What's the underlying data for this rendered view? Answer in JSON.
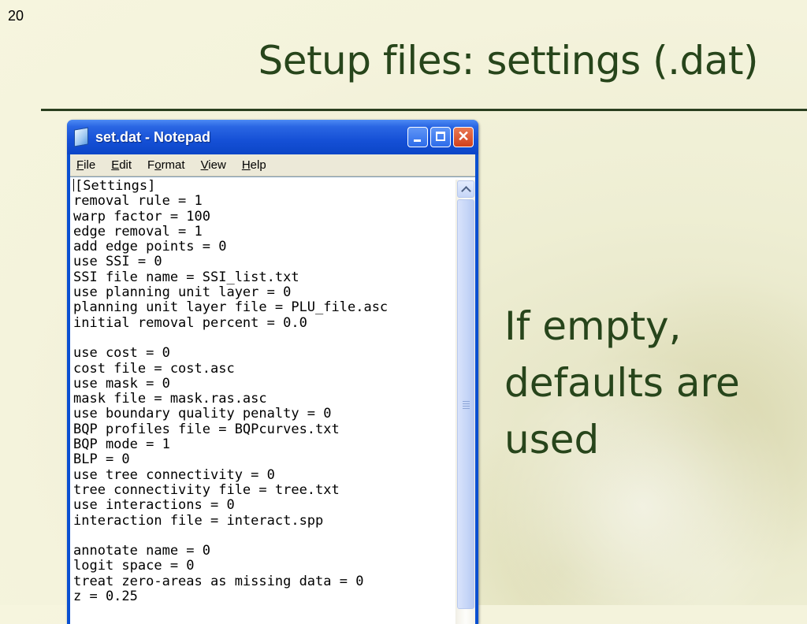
{
  "slide": {
    "number": "20",
    "title": "Setup files: settings (.dat)",
    "side_text": [
      "If empty,",
      "defaults are",
      "used"
    ]
  },
  "window": {
    "title": "set.dat - Notepad",
    "controls": {
      "minimize": "minimize",
      "maximize": "maximize",
      "close": "✕"
    }
  },
  "menu": [
    {
      "label": "File",
      "mnemonic": "F",
      "rest": "ile"
    },
    {
      "label": "Edit",
      "mnemonic": "E",
      "rest": "dit"
    },
    {
      "label": "Format",
      "mnemonic": "o",
      "pre": "F",
      "rest": "rmat"
    },
    {
      "label": "View",
      "mnemonic": "V",
      "rest": "iew"
    },
    {
      "label": "Help",
      "mnemonic": "H",
      "rest": "elp"
    }
  ],
  "editor_lines": [
    "[Settings]",
    "removal rule = 1",
    "warp factor = 100",
    "edge removal = 1",
    "add edge points = 0",
    "use SSI = 0",
    "SSI file name = SSI_list.txt",
    "use planning unit layer = 0",
    "planning unit layer file = PLU_file.asc",
    "initial removal percent = 0.0",
    "",
    "use cost = 0",
    "cost file = cost.asc",
    "use mask = 0",
    "mask file = mask.ras.asc",
    "use boundary quality penalty = 0",
    "BQP profiles file = BQPcurves.txt",
    "BQP mode = 1",
    "BLP = 0",
    "use tree connectivity = 0",
    "tree connectivity file = tree.txt",
    "use interactions = 0",
    "interaction file = interact.spp",
    "",
    "annotate name = 0",
    "logit space = 0",
    "treat zero-areas as missing data = 0",
    "z = 0.25"
  ],
  "colors": {
    "title_text": "#27451b",
    "titlebar_blue": "#0b45c7",
    "close_red": "#d2401c",
    "menubar_bg": "#ece9d8"
  }
}
